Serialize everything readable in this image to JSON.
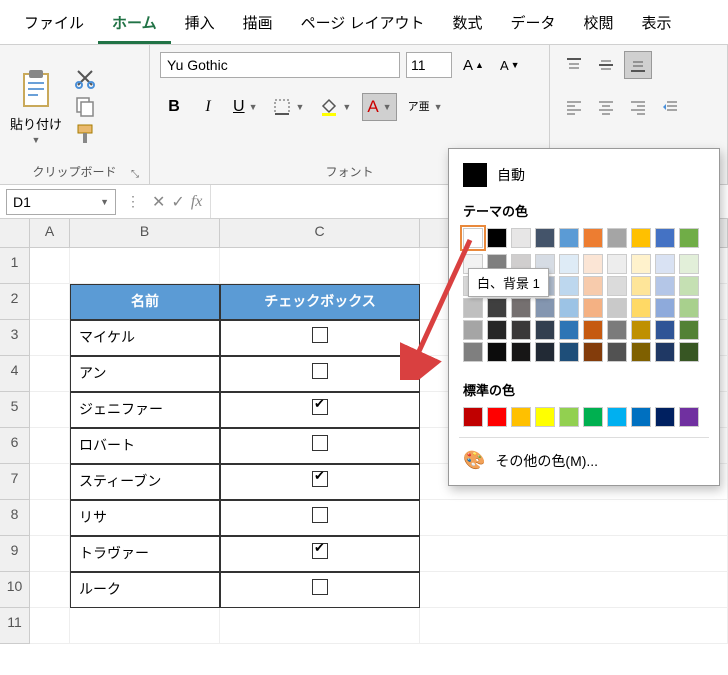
{
  "tabs": [
    "ファイル",
    "ホーム",
    "挿入",
    "描画",
    "ページ レイアウト",
    "数式",
    "データ",
    "校閲",
    "表示"
  ],
  "active_tab": 1,
  "clipboard": {
    "paste": "貼り付け",
    "group": "クリップボード"
  },
  "font": {
    "name": "Yu Gothic",
    "size": "11",
    "group": "フォント",
    "bold": "B",
    "italic": "I",
    "underline": "U",
    "ruby": "ア亜"
  },
  "namebox": "D1",
  "columns": [
    "A",
    "B",
    "C"
  ],
  "rows": [
    "1",
    "2",
    "3",
    "4",
    "5",
    "6",
    "7",
    "8",
    "9",
    "10",
    "11"
  ],
  "table": {
    "headers": [
      "名前",
      "チェックボックス"
    ],
    "rows": [
      {
        "name": "マイケル",
        "checked": false
      },
      {
        "name": "アン",
        "checked": false
      },
      {
        "name": "ジェニファー",
        "checked": true
      },
      {
        "name": "ロバート",
        "checked": false
      },
      {
        "name": "スティーブン",
        "checked": true
      },
      {
        "name": "リサ",
        "checked": false
      },
      {
        "name": "トラヴァー",
        "checked": true
      },
      {
        "name": "ルーク",
        "checked": false
      }
    ]
  },
  "picker": {
    "auto": "自動",
    "theme": "テーマの色",
    "standard": "標準の色",
    "more": "その他の色(M)...",
    "tooltip": "白、背景 1",
    "theme_colors": [
      "#ffffff",
      "#000000",
      "#e7e6e6",
      "#44546a",
      "#5b9bd5",
      "#ed7d31",
      "#a5a5a5",
      "#ffc000",
      "#4472c4",
      "#70ad47"
    ],
    "theme_shades": [
      [
        "#f2f2f2",
        "#7f7f7f",
        "#d0cece",
        "#d6dce4",
        "#deebf6",
        "#fbe5d5",
        "#ededed",
        "#fff2cc",
        "#d9e2f3",
        "#e2efd9"
      ],
      [
        "#d8d8d8",
        "#595959",
        "#aeabab",
        "#adb9ca",
        "#bdd7ee",
        "#f7cbac",
        "#dbdbdb",
        "#fee599",
        "#b4c6e7",
        "#c5e0b3"
      ],
      [
        "#bfbfbf",
        "#3f3f3f",
        "#757070",
        "#8496b0",
        "#9cc3e5",
        "#f4b183",
        "#c9c9c9",
        "#ffd965",
        "#8eaadb",
        "#a8d08d"
      ],
      [
        "#a5a5a5",
        "#262626",
        "#3a3838",
        "#323f4f",
        "#2e75b5",
        "#c55a11",
        "#7b7b7b",
        "#bf9000",
        "#2f5496",
        "#538135"
      ],
      [
        "#7f7f7f",
        "#0c0c0c",
        "#171616",
        "#222a35",
        "#1e4e79",
        "#833c0b",
        "#525252",
        "#7f6000",
        "#1f3864",
        "#375623"
      ]
    ],
    "standard_colors": [
      "#c00000",
      "#ff0000",
      "#ffc000",
      "#ffff00",
      "#92d050",
      "#00b050",
      "#00b0f0",
      "#0070c0",
      "#002060",
      "#7030a0"
    ]
  }
}
